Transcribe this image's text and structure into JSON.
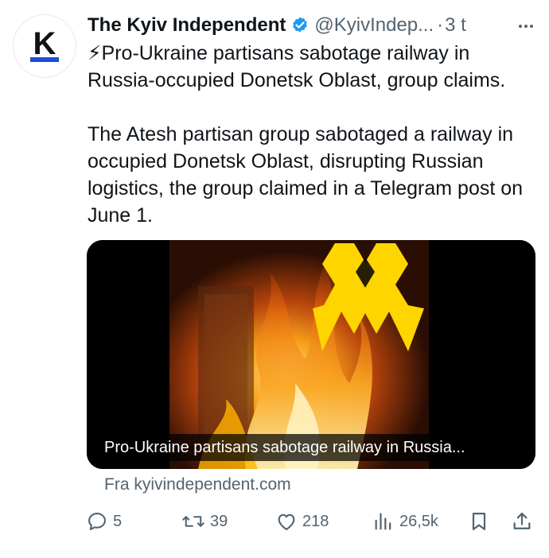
{
  "account": {
    "display_name": "The Kyiv Independent",
    "handle": "@KyivIndep...",
    "separator": "·",
    "time": "3 t",
    "avatar_letter": "K",
    "verified": true,
    "verified_color": "#1d9bf0"
  },
  "tweet": {
    "headline": "⚡Pro-Ukraine partisans sabotage railway in Russia-occupied Donetsk Oblast, group claims.",
    "body": "The Atesh partisan group sabotaged a railway in occupied Donetsk Oblast, disrupting Russian logistics, the group claimed in a Telegram post on June 1."
  },
  "link_card": {
    "caption": "Pro-Ukraine partisans sabotage railway in Russia...",
    "source": "Fra kyivindependent.com",
    "logo_color": "#ffd500"
  },
  "actions": {
    "replies": "5",
    "reposts": "39",
    "likes": "218",
    "views": "26,5k"
  },
  "colors": {
    "text": "#0f1419",
    "secondary": "#536471",
    "accent": "#1d9bf0"
  },
  "icons": [
    "more-icon",
    "verified-badge-icon",
    "reply-icon",
    "repost-icon",
    "like-icon",
    "views-icon",
    "bookmark-icon",
    "share-icon"
  ]
}
